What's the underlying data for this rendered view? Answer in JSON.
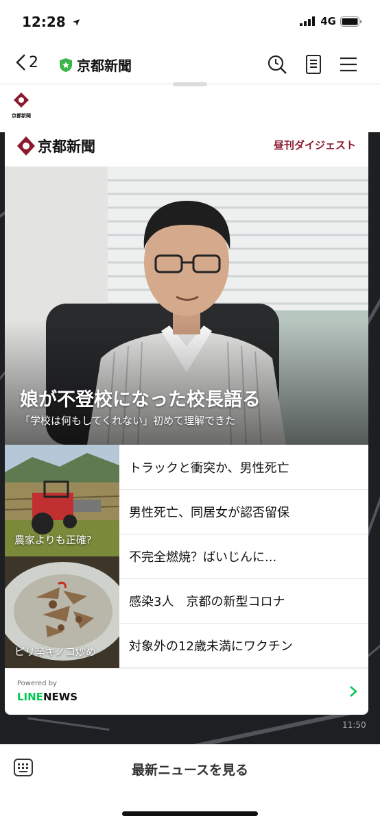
{
  "status": {
    "time": "12:28",
    "network": "4G"
  },
  "nav": {
    "back_count": "2",
    "title": "京都新聞"
  },
  "publisher": {
    "logo_text": "京都新聞",
    "section_label": "昼刊ダイジェスト",
    "brand_color": "#8b1a2f"
  },
  "hero": {
    "title": "娘が不登校になった校長語る",
    "subtitle": "「学校は何もしてくれない」初めて理解できた"
  },
  "thumbnails": [
    {
      "caption": "農家よりも正確?"
    },
    {
      "caption": "ピリ辛キノコ炒め"
    }
  ],
  "headlines": [
    "トラックと衝突か、男性死亡",
    "男性死亡、同居女が認否留保",
    "不完全燃焼？ばいじんに...",
    "感染3人　京都の新型コロナ",
    "対象外の12歳未満にワクチン"
  ],
  "footer": {
    "powered_by": "Powered by",
    "brand_line": "LINE",
    "brand_news": "NEWS",
    "line_green": "#06c755"
  },
  "timestamp": "11:50",
  "bottom": {
    "label": "最新ニュースを見る"
  }
}
